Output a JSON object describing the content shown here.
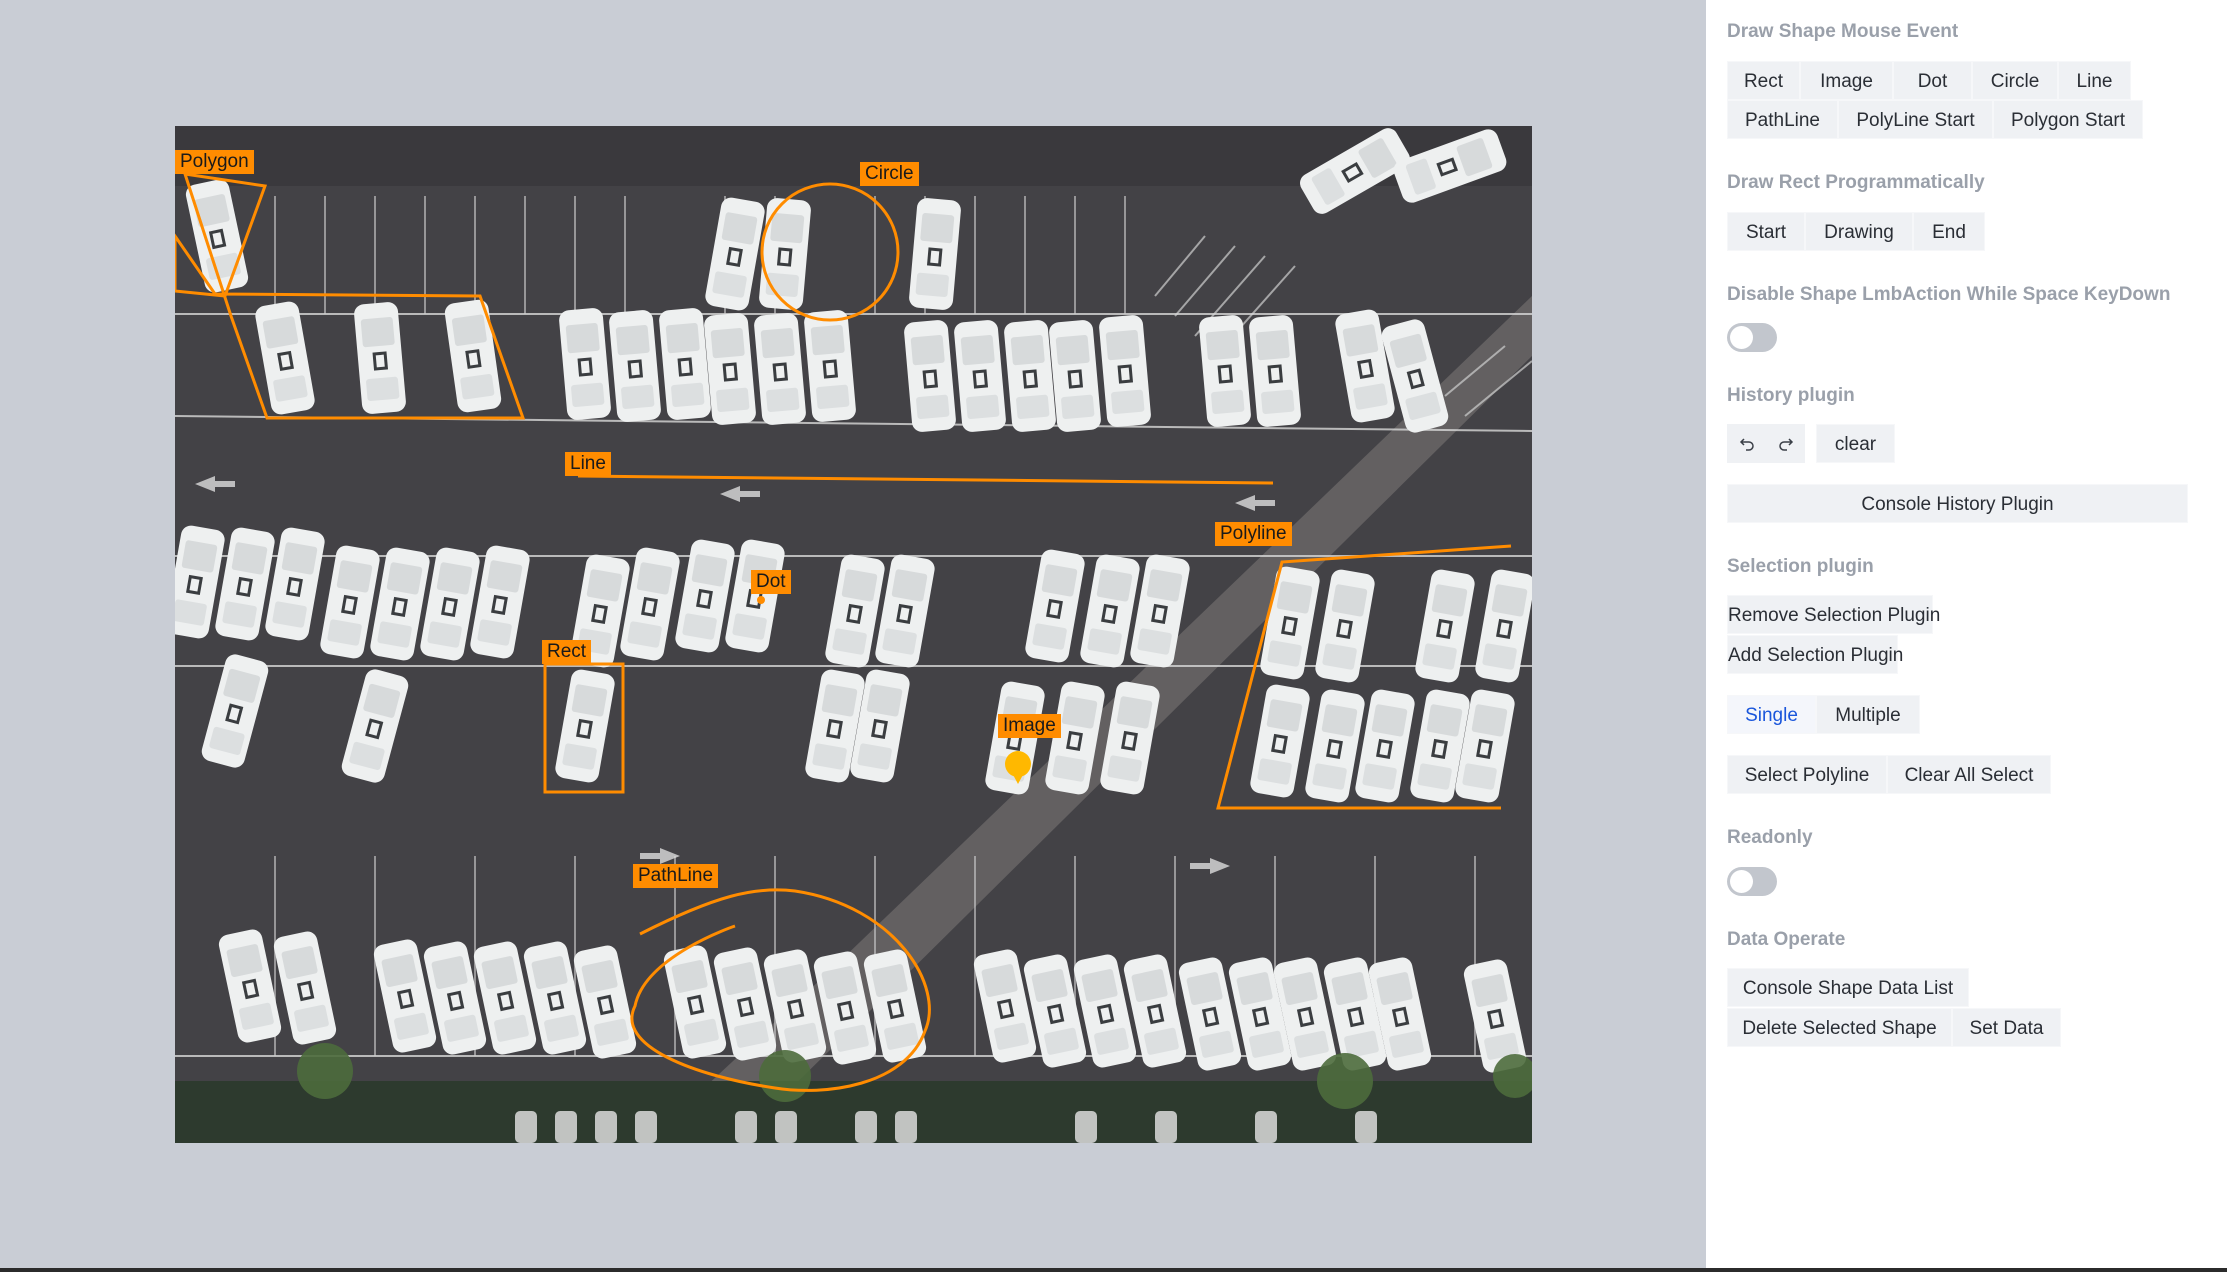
{
  "canvas": {
    "shape_labels": {
      "polygon": "Polygon",
      "circle": "Circle",
      "line": "Line",
      "polyline": "Polyline",
      "dot": "Dot",
      "rect": "Rect",
      "image": "Image",
      "pathline": "PathLine"
    },
    "shape_color": "#ff8c00",
    "photo_subject": "aerial view of parking lot with rows of white RVs"
  },
  "panel": {
    "draw_mouse": {
      "title": "Draw Shape Mouse Event",
      "buttons": [
        "Rect",
        "Image",
        "Dot",
        "Circle",
        "Line",
        "PathLine",
        "PolyLine Start",
        "Polygon Start"
      ]
    },
    "draw_rect": {
      "title": "Draw Rect Programmatically",
      "buttons": [
        "Start",
        "Drawing",
        "End"
      ]
    },
    "disable_space": {
      "title": "Disable Shape LmbAction While Space KeyDown",
      "enabled": false
    },
    "history": {
      "title": "History plugin",
      "undo_icon": "undo-icon",
      "redo_icon": "redo-icon",
      "clear": "clear",
      "console": "Console History Plugin"
    },
    "selection": {
      "title": "Selection plugin",
      "remove": "Remove Selection Plugin",
      "add": "Add Selection Plugin",
      "single": "Single",
      "multiple": "Multiple",
      "select_polyline": "Select Polyline",
      "clear_all": "Clear All Select"
    },
    "readonly": {
      "title": "Readonly",
      "enabled": false
    },
    "data_operate": {
      "title": "Data Operate",
      "console": "Console Shape Data List",
      "delete": "Delete Selected Shape",
      "set_data": "Set Data"
    }
  }
}
